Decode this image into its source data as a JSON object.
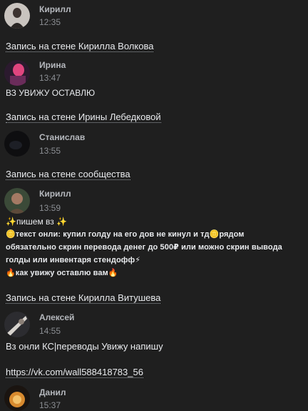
{
  "entries": [
    {
      "author": "Кирилл",
      "time": "12:35",
      "post_link": "Запись на стене Кирилла Волкова"
    },
    {
      "author": "Ирина",
      "time": "13:47",
      "message": "ВЗ УВИЖУ ОСТАВЛЮ",
      "post_link": "Запись на стене Ирины Лебедковой"
    },
    {
      "author": "Станислав",
      "time": "13:55",
      "post_link": "Запись на стене сообщества"
    },
    {
      "author": "Кирилл",
      "time": "13:59",
      "lines": [
        "✨пишем вз ✨",
        "🪙текст онли: купил голду на его дов не кинул и тд🪙рядом",
        "обязательно скрин перевода денег до 500₽ или можно скрин вывода",
        "голды или инвентаря стендофф⚡",
        "🔥как увижу оставлю вам🔥"
      ],
      "post_link": "Запись на стене Кирилла Витушева"
    },
    {
      "author": "Алексей",
      "time": "14:55",
      "message": "Вз онли КС|переводы Увижу напишу",
      "url": "https://vk.com/wall588418783_56"
    },
    {
      "author": "Данил",
      "time": "15:37"
    }
  ]
}
